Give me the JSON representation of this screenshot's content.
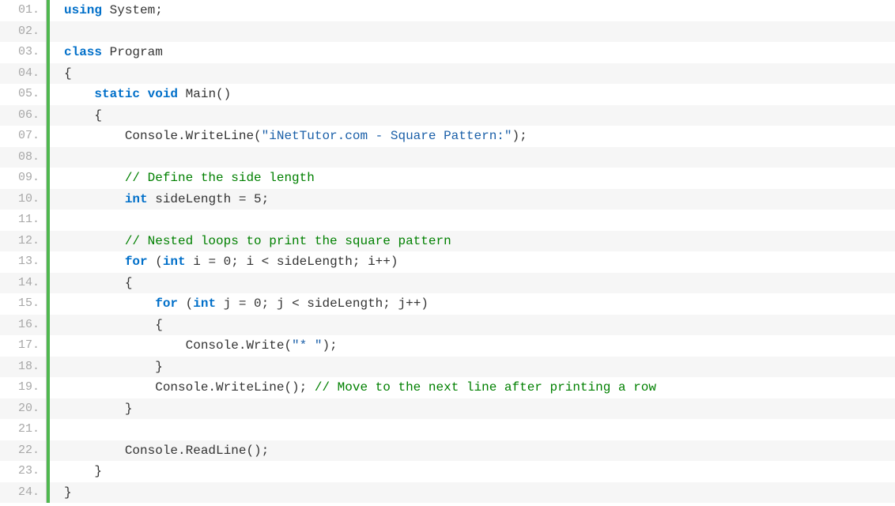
{
  "language": "csharp",
  "lines": [
    {
      "num": "01.",
      "tokens": [
        {
          "cls": "tok-kw",
          "t": "using"
        },
        {
          "cls": "tok-txt",
          "t": " System;"
        }
      ]
    },
    {
      "num": "02.",
      "tokens": []
    },
    {
      "num": "03.",
      "tokens": [
        {
          "cls": "tok-kw",
          "t": "class"
        },
        {
          "cls": "tok-txt",
          "t": " Program"
        }
      ]
    },
    {
      "num": "04.",
      "tokens": [
        {
          "cls": "tok-txt",
          "t": "{"
        }
      ]
    },
    {
      "num": "05.",
      "tokens": [
        {
          "cls": "tok-txt",
          "t": "    "
        },
        {
          "cls": "tok-kw",
          "t": "static"
        },
        {
          "cls": "tok-txt",
          "t": " "
        },
        {
          "cls": "tok-kw",
          "t": "void"
        },
        {
          "cls": "tok-txt",
          "t": " Main()"
        }
      ]
    },
    {
      "num": "06.",
      "tokens": [
        {
          "cls": "tok-txt",
          "t": "    {"
        }
      ]
    },
    {
      "num": "07.",
      "tokens": [
        {
          "cls": "tok-txt",
          "t": "        Console.WriteLine("
        },
        {
          "cls": "tok-str",
          "t": "\"iNetTutor.com - Square Pattern:\""
        },
        {
          "cls": "tok-txt",
          "t": ");"
        }
      ]
    },
    {
      "num": "08.",
      "tokens": []
    },
    {
      "num": "09.",
      "tokens": [
        {
          "cls": "tok-txt",
          "t": "        "
        },
        {
          "cls": "tok-cmt",
          "t": "// Define the side length"
        }
      ]
    },
    {
      "num": "10.",
      "tokens": [
        {
          "cls": "tok-txt",
          "t": "        "
        },
        {
          "cls": "tok-kw",
          "t": "int"
        },
        {
          "cls": "tok-txt",
          "t": " sideLength = 5;"
        }
      ]
    },
    {
      "num": "11.",
      "tokens": []
    },
    {
      "num": "12.",
      "tokens": [
        {
          "cls": "tok-txt",
          "t": "        "
        },
        {
          "cls": "tok-cmt",
          "t": "// Nested loops to print the square pattern"
        }
      ]
    },
    {
      "num": "13.",
      "tokens": [
        {
          "cls": "tok-txt",
          "t": "        "
        },
        {
          "cls": "tok-kw",
          "t": "for"
        },
        {
          "cls": "tok-txt",
          "t": " ("
        },
        {
          "cls": "tok-kw",
          "t": "int"
        },
        {
          "cls": "tok-txt",
          "t": " i = 0; i < sideLength; i++)"
        }
      ]
    },
    {
      "num": "14.",
      "tokens": [
        {
          "cls": "tok-txt",
          "t": "        {"
        }
      ]
    },
    {
      "num": "15.",
      "tokens": [
        {
          "cls": "tok-txt",
          "t": "            "
        },
        {
          "cls": "tok-kw",
          "t": "for"
        },
        {
          "cls": "tok-txt",
          "t": " ("
        },
        {
          "cls": "tok-kw",
          "t": "int"
        },
        {
          "cls": "tok-txt",
          "t": " j = 0; j < sideLength; j++)"
        }
      ]
    },
    {
      "num": "16.",
      "tokens": [
        {
          "cls": "tok-txt",
          "t": "            {"
        }
      ]
    },
    {
      "num": "17.",
      "tokens": [
        {
          "cls": "tok-txt",
          "t": "                Console.Write("
        },
        {
          "cls": "tok-str",
          "t": "\"* \""
        },
        {
          "cls": "tok-txt",
          "t": ");"
        }
      ]
    },
    {
      "num": "18.",
      "tokens": [
        {
          "cls": "tok-txt",
          "t": "            }"
        }
      ]
    },
    {
      "num": "19.",
      "tokens": [
        {
          "cls": "tok-txt",
          "t": "            Console.WriteLine(); "
        },
        {
          "cls": "tok-cmt",
          "t": "// Move to the next line after printing a row"
        }
      ]
    },
    {
      "num": "20.",
      "tokens": [
        {
          "cls": "tok-txt",
          "t": "        }"
        }
      ]
    },
    {
      "num": "21.",
      "tokens": []
    },
    {
      "num": "22.",
      "tokens": [
        {
          "cls": "tok-txt",
          "t": "        Console.ReadLine();"
        }
      ]
    },
    {
      "num": "23.",
      "tokens": [
        {
          "cls": "tok-txt",
          "t": "    }"
        }
      ]
    },
    {
      "num": "24.",
      "tokens": [
        {
          "cls": "tok-txt",
          "t": "}"
        }
      ]
    }
  ]
}
